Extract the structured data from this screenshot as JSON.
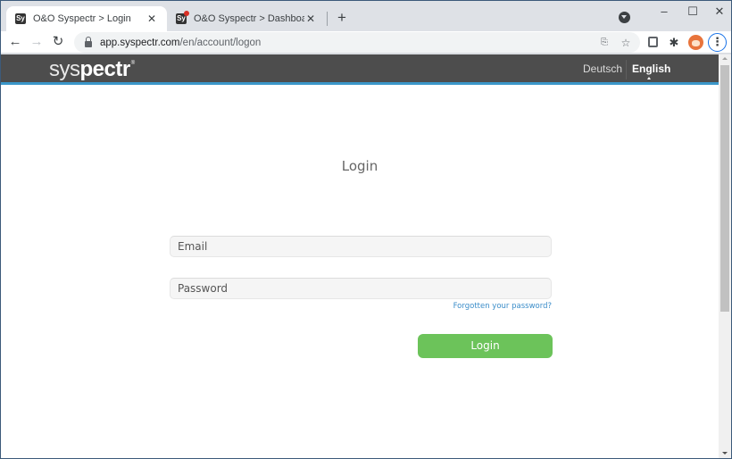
{
  "browser": {
    "tabs": [
      {
        "favicon": "Sy",
        "title": "O&O Syspectr > Login",
        "active": true
      },
      {
        "favicon": "Sy",
        "title": "O&O Syspectr > Dashboard",
        "active": false,
        "has_notification": true
      }
    ],
    "new_tab_label": "+",
    "window_controls": {
      "minimize": "–",
      "maximize": "☐",
      "close": "✕"
    },
    "nav": {
      "back": "←",
      "forward": "→",
      "reload": "↻"
    },
    "url": {
      "host": "app.syspectr.com",
      "path": "/en/account/logon"
    },
    "icons": {
      "translate": "translate-icon",
      "bookmark": "☆",
      "bitwarden": "bitwarden-icon",
      "extensions": "✱",
      "menu": "⋮"
    }
  },
  "site": {
    "logo": {
      "light": "sys",
      "bold": "pectr",
      "mark": "®"
    },
    "languages": [
      {
        "label": "Deutsch",
        "active": false
      },
      {
        "label": "English",
        "active": true
      }
    ],
    "colors": {
      "header_bg": "#4d4d4d",
      "header_accent": "#3b97c9",
      "button_green": "#6cc35a",
      "link_blue": "#3b8dc9"
    }
  },
  "login": {
    "title": "Login",
    "email": {
      "placeholder": "Email",
      "value": ""
    },
    "password": {
      "placeholder": "Password",
      "value": ""
    },
    "forgot_link": "Forgotten your password?",
    "submit_label": "Login"
  }
}
